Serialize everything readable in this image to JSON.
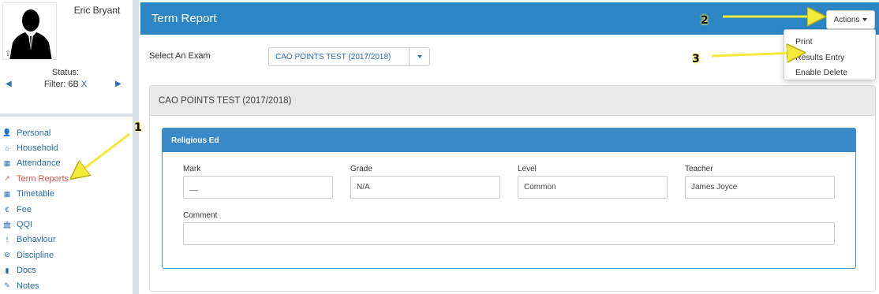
{
  "student": {
    "name": "Eric Bryant",
    "status_label": "Status:",
    "filter_label": "Filter: 6B",
    "filter_clear": "X"
  },
  "sidebar": {
    "items": [
      {
        "label": "Personal",
        "icon": "person-icon",
        "glyph": "👤"
      },
      {
        "label": "Household",
        "icon": "home-icon",
        "glyph": "⌂"
      },
      {
        "label": "Attendance",
        "icon": "calendar-icon",
        "glyph": "▦"
      },
      {
        "label": "Term Reports",
        "icon": "line-chart-icon",
        "glyph": "↗",
        "active": true
      },
      {
        "label": "Timetable",
        "icon": "calendar-icon",
        "glyph": "▦"
      },
      {
        "label": "Fee",
        "icon": "euro-icon",
        "glyph": "€"
      },
      {
        "label": "QQI",
        "icon": "institution-icon",
        "glyph": "🏛"
      },
      {
        "label": "Behaviour",
        "icon": "exclamation-icon",
        "glyph": "!"
      },
      {
        "label": "Discipline",
        "icon": "ban-icon",
        "glyph": "⊘"
      },
      {
        "label": "Docs",
        "icon": "document-icon",
        "glyph": "▮"
      },
      {
        "label": "Notes",
        "icon": "edit-icon",
        "glyph": "✎"
      }
    ]
  },
  "header": {
    "title": "Term Report",
    "actions_label": "Actions"
  },
  "actions_menu": {
    "items": [
      "Print",
      "Results Entry",
      "Enable Delete"
    ]
  },
  "exam_select": {
    "label": "Select An Exam",
    "value": "CAO POINTS TEST (2017/2018)"
  },
  "exam_panel": {
    "title": "CAO POINTS TEST (2017/2018)"
  },
  "subject": {
    "name": "Religious Ed",
    "fields": {
      "mark_label": "Mark",
      "mark_value": "__",
      "grade_label": "Grade",
      "grade_value": "N/A",
      "level_label": "Level",
      "level_value": "Common",
      "teacher_label": "Teacher",
      "teacher_value": "James Joyce",
      "comment_label": "Comment",
      "comment_value": ""
    }
  },
  "annotations": {
    "callout_1": "1",
    "callout_2": "2",
    "callout_3": "3",
    "arrow_color": "#f2e93a"
  },
  "colors": {
    "header_blue": "#2c86c5",
    "link_blue": "#2a6fb0",
    "active_red": "#d9534f"
  }
}
